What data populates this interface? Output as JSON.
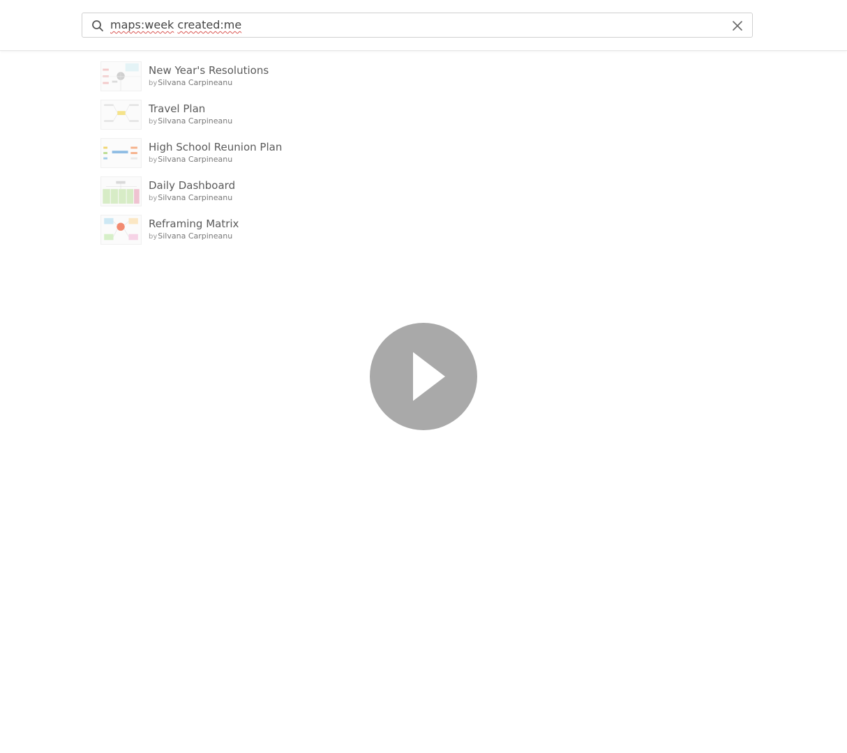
{
  "search": {
    "query_part1": "maps:week",
    "query_part2": "created:me",
    "icon": "search-icon",
    "clear_icon": "close-icon"
  },
  "results": [
    {
      "title": "New Year's Resolutions",
      "by": "by",
      "author": "Silvana Carpineanu",
      "thumb_colors": [
        "#d9d9d9",
        "#f2c4c4",
        "#cfe8ee"
      ]
    },
    {
      "title": "Travel Plan",
      "by": "by",
      "author": "Silvana Carpineanu",
      "thumb_colors": [
        "#f5e38a",
        "#dcdcdc",
        "#e6e6e6"
      ]
    },
    {
      "title": "High School Reunion Plan",
      "by": "by",
      "author": "Silvana Carpineanu",
      "thumb_colors": [
        "#7fb3e0",
        "#f2d26b",
        "#f5a97a"
      ]
    },
    {
      "title": "Daily Dashboard",
      "by": "by",
      "author": "Silvana Carpineanu",
      "thumb_colors": [
        "#c8e6b5",
        "#e8b4c4",
        "#d9d9d9"
      ]
    },
    {
      "title": "Reframing Matrix",
      "by": "by",
      "author": "Silvana Carpineanu",
      "thumb_colors": [
        "#f07a5e",
        "#bfe0f0",
        "#f4c6de"
      ]
    }
  ],
  "overlay": {
    "icon": "play-icon",
    "color": "#a9a9a9"
  }
}
